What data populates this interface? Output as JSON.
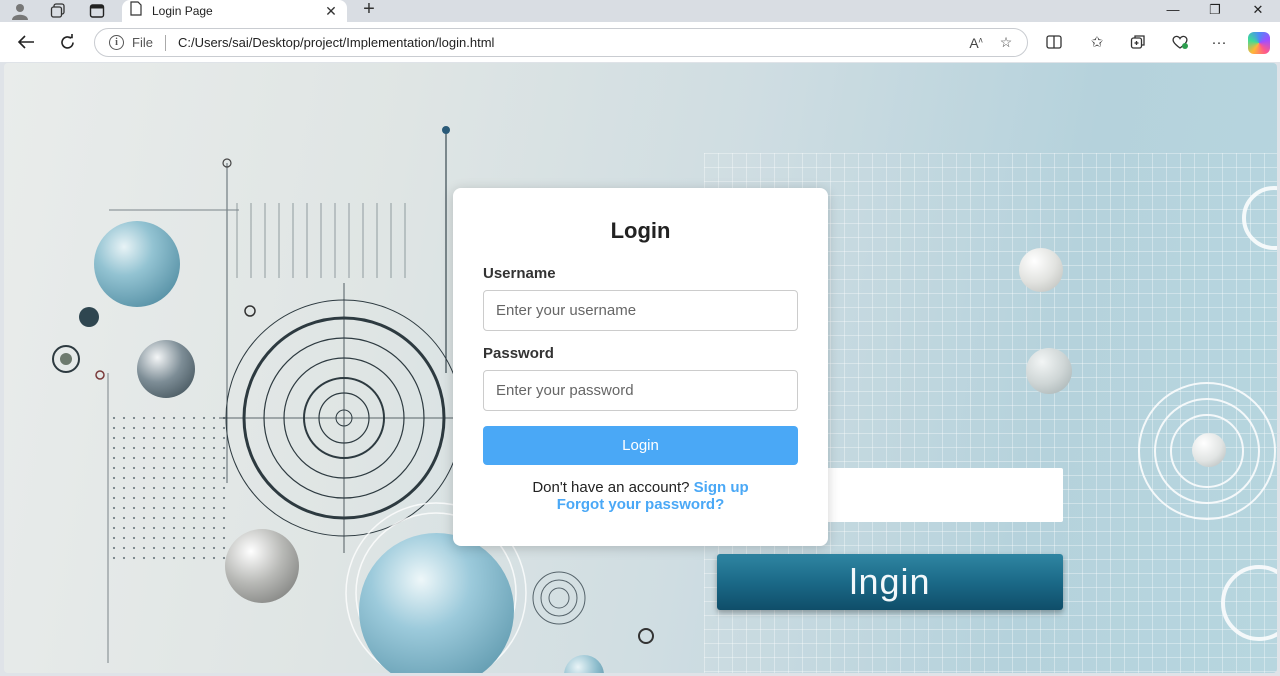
{
  "browser": {
    "tab_title": "Login Page",
    "address_scheme_label": "File",
    "url": "C:/Users/sai/Desktop/project/Implementation/login.html"
  },
  "login_form": {
    "heading": "Login",
    "username_label": "Username",
    "username_placeholder": "Enter your username",
    "username_value": "",
    "password_label": "Password",
    "password_placeholder": "Enter your password",
    "password_value": "",
    "submit_label": "Login",
    "signup_prompt": "Don't have an account?",
    "signup_link": "Sign up",
    "forgot_link": "Forgot your password?"
  },
  "background": {
    "button_text": "lngin"
  },
  "colors": {
    "accent": "#4aa8f6",
    "card_bg": "#ffffff"
  }
}
